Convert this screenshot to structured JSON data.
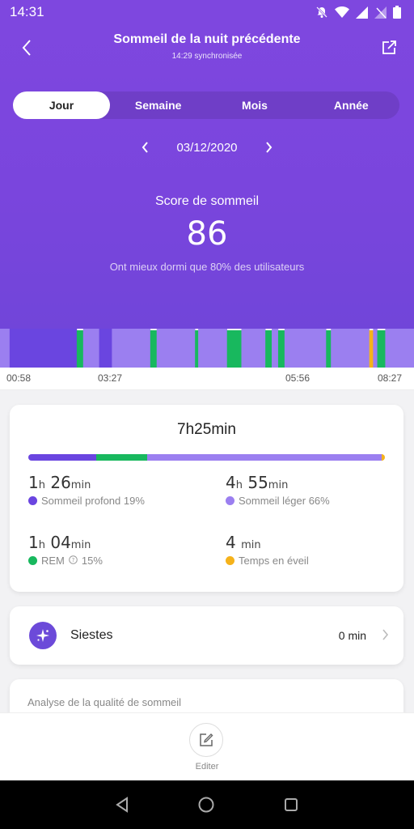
{
  "status_bar": {
    "time": "14:31"
  },
  "header": {
    "title": "Sommeil de la nuit précédente",
    "sync_text": "14:29 synchronisée"
  },
  "tabs": [
    {
      "label": "Jour",
      "active": true
    },
    {
      "label": "Semaine",
      "active": false
    },
    {
      "label": "Mois",
      "active": false
    },
    {
      "label": "Année",
      "active": false
    }
  ],
  "date_nav": {
    "date": "03/12/2020"
  },
  "score": {
    "label": "Score de sommeil",
    "value": "86",
    "subtitle": "Ont mieux dormi que 80% des utilisateurs"
  },
  "timeline": {
    "time_labels": [
      "00:58",
      "03:27",
      "05:56",
      "08:27"
    ],
    "segments": [
      {
        "stage": "light",
        "duration": 3
      },
      {
        "stage": "deep",
        "duration": 21
      },
      {
        "stage": "rem",
        "duration": 2
      },
      {
        "stage": "light",
        "duration": 5
      },
      {
        "stage": "deep",
        "duration": 4
      },
      {
        "stage": "light",
        "duration": 12
      },
      {
        "stage": "rem",
        "duration": 2
      },
      {
        "stage": "light",
        "duration": 12
      },
      {
        "stage": "rem",
        "duration": 1
      },
      {
        "stage": "light",
        "duration": 9
      },
      {
        "stage": "rem",
        "duration": 4.5
      },
      {
        "stage": "light",
        "duration": 7.5
      },
      {
        "stage": "rem",
        "duration": 2
      },
      {
        "stage": "light",
        "duration": 2
      },
      {
        "stage": "rem",
        "duration": 2
      },
      {
        "stage": "light",
        "duration": 13
      },
      {
        "stage": "rem",
        "duration": 1.5
      },
      {
        "stage": "light",
        "duration": 12
      },
      {
        "stage": "awake",
        "duration": 1.2
      },
      {
        "stage": "light",
        "duration": 1.3
      },
      {
        "stage": "rem",
        "duration": 2.5
      },
      {
        "stage": "light",
        "duration": 9
      }
    ]
  },
  "summary": {
    "total": "7h25min",
    "deep": {
      "h": "1",
      "m": "26",
      "label": "Sommeil profond 19%",
      "minutes": 86
    },
    "light": {
      "h": "4",
      "m": "55",
      "label": "Sommeil léger 66%",
      "minutes": 295
    },
    "rem": {
      "h": "1",
      "m": "04",
      "label": "REM",
      "percent": "15%",
      "minutes": 64
    },
    "awake": {
      "m": "4",
      "label": "Temps en éveil",
      "minutes": 4
    },
    "unit_h": "h",
    "unit_min": "min"
  },
  "naps": {
    "label": "Siestes",
    "value": "0 min"
  },
  "analysis": {
    "title": "Analyse de la qualité de sommeil"
  },
  "bottom": {
    "edit_label": "Editer"
  },
  "colors": {
    "header": "#7e47df",
    "deep": "#6a45e0",
    "light": "#9b7ff0",
    "rem": "#18b85e",
    "awake": "#f5b21b"
  }
}
